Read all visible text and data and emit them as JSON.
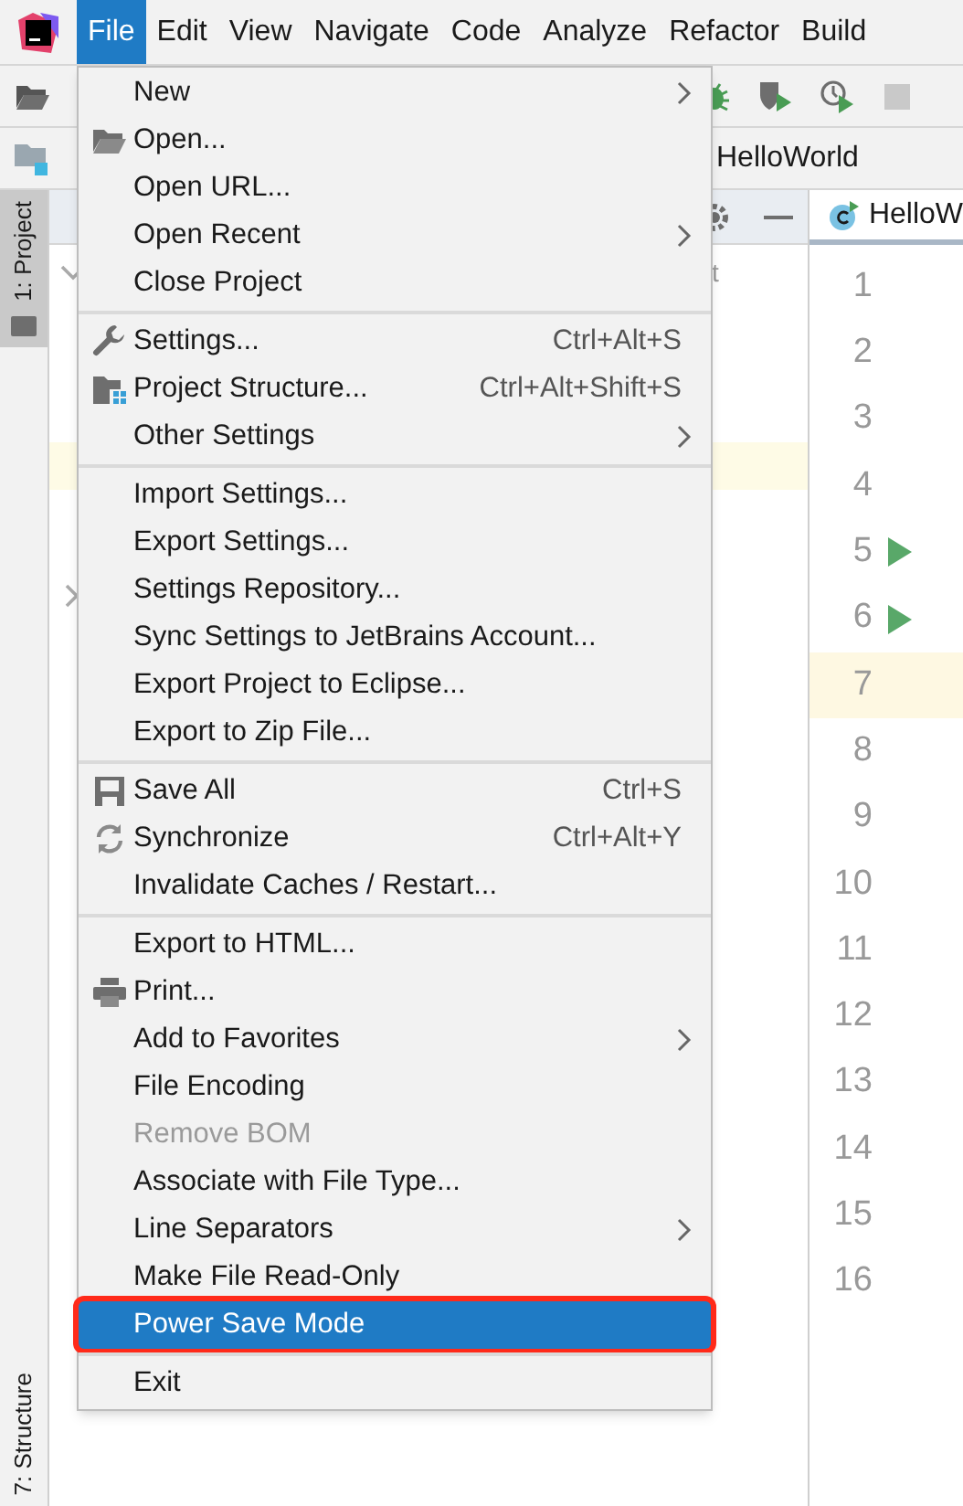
{
  "menubar": [
    {
      "label": "File",
      "selected": true
    },
    {
      "label": "Edit",
      "selected": false
    },
    {
      "label": "View",
      "selected": false
    },
    {
      "label": "Navigate",
      "selected": false
    },
    {
      "label": "Code",
      "selected": false
    },
    {
      "label": "Analyze",
      "selected": false
    },
    {
      "label": "Refactor",
      "selected": false
    },
    {
      "label": "Build",
      "selected": false
    }
  ],
  "navbar": {
    "path": "HelloWorld"
  },
  "side_tabs": [
    {
      "label": "1: Project",
      "selected": true
    },
    {
      "label": "7: Structure",
      "selected": false
    }
  ],
  "project_panel": {
    "partial_text": "t"
  },
  "editor": {
    "tab": "HelloW",
    "lines": [
      {
        "number": "1",
        "run": false,
        "current": false
      },
      {
        "number": "2",
        "run": false,
        "current": false
      },
      {
        "number": "3",
        "run": false,
        "current": false
      },
      {
        "number": "4",
        "run": false,
        "current": false
      },
      {
        "number": "5",
        "run": true,
        "current": false
      },
      {
        "number": "6",
        "run": true,
        "current": false
      },
      {
        "number": "7",
        "run": false,
        "current": true
      },
      {
        "number": "8",
        "run": false,
        "current": false
      },
      {
        "number": "9",
        "run": false,
        "current": false
      },
      {
        "number": "10",
        "run": false,
        "current": false
      },
      {
        "number": "11",
        "run": false,
        "current": false
      },
      {
        "number": "12",
        "run": false,
        "current": false
      },
      {
        "number": "13",
        "run": false,
        "current": false
      },
      {
        "number": "14",
        "run": false,
        "current": false
      },
      {
        "number": "15",
        "run": false,
        "current": false
      },
      {
        "number": "16",
        "run": false,
        "current": false
      }
    ]
  },
  "file_menu": {
    "groups": [
      {
        "items": [
          {
            "label": "New",
            "submenu": true,
            "disabled": false,
            "selected": false
          },
          {
            "label": "Open...",
            "disabled": false,
            "selected": false
          },
          {
            "label": "Open URL...",
            "disabled": false,
            "selected": false
          },
          {
            "label": "Open Recent",
            "submenu": true,
            "disabled": false,
            "selected": false
          },
          {
            "label": "Close Project",
            "disabled": false,
            "selected": false
          }
        ]
      },
      {
        "items": [
          {
            "label": "Settings...",
            "shortcut": "Ctrl+Alt+S",
            "disabled": false,
            "selected": false
          },
          {
            "label": "Project Structure...",
            "shortcut": "Ctrl+Alt+Shift+S",
            "disabled": false,
            "selected": false
          },
          {
            "label": "Other Settings",
            "submenu": true,
            "disabled": false,
            "selected": false
          }
        ]
      },
      {
        "items": [
          {
            "label": "Import Settings...",
            "disabled": false,
            "selected": false
          },
          {
            "label": "Export Settings...",
            "disabled": false,
            "selected": false
          },
          {
            "label": "Settings Repository...",
            "disabled": false,
            "selected": false
          },
          {
            "label": "Sync Settings to JetBrains Account...",
            "disabled": false,
            "selected": false
          },
          {
            "label": "Export Project to Eclipse...",
            "disabled": false,
            "selected": false
          },
          {
            "label": "Export to Zip File...",
            "disabled": false,
            "selected": false
          }
        ]
      },
      {
        "items": [
          {
            "label": "Save All",
            "shortcut": "Ctrl+S",
            "disabled": false,
            "selected": false
          },
          {
            "label": "Synchronize",
            "shortcut": "Ctrl+Alt+Y",
            "disabled": false,
            "selected": false
          },
          {
            "label": "Invalidate Caches / Restart...",
            "disabled": false,
            "selected": false
          }
        ]
      },
      {
        "items": [
          {
            "label": "Export to HTML...",
            "disabled": false,
            "selected": false
          },
          {
            "label": "Print...",
            "disabled": false,
            "selected": false
          },
          {
            "label": "Add to Favorites",
            "submenu": true,
            "disabled": false,
            "selected": false
          },
          {
            "label": "File Encoding",
            "disabled": false,
            "selected": false
          },
          {
            "label": "Remove BOM",
            "disabled": true,
            "selected": false
          },
          {
            "label": "Associate with File Type...",
            "disabled": false,
            "selected": false
          },
          {
            "label": "Line Separators",
            "submenu": true,
            "disabled": false,
            "selected": false
          },
          {
            "label": "Make File Read-Only",
            "disabled": false,
            "selected": false
          },
          {
            "label": "Power Save Mode",
            "disabled": false,
            "selected": true
          }
        ]
      },
      {
        "items": [
          {
            "label": "Exit",
            "disabled": false,
            "selected": false
          }
        ]
      }
    ]
  }
}
